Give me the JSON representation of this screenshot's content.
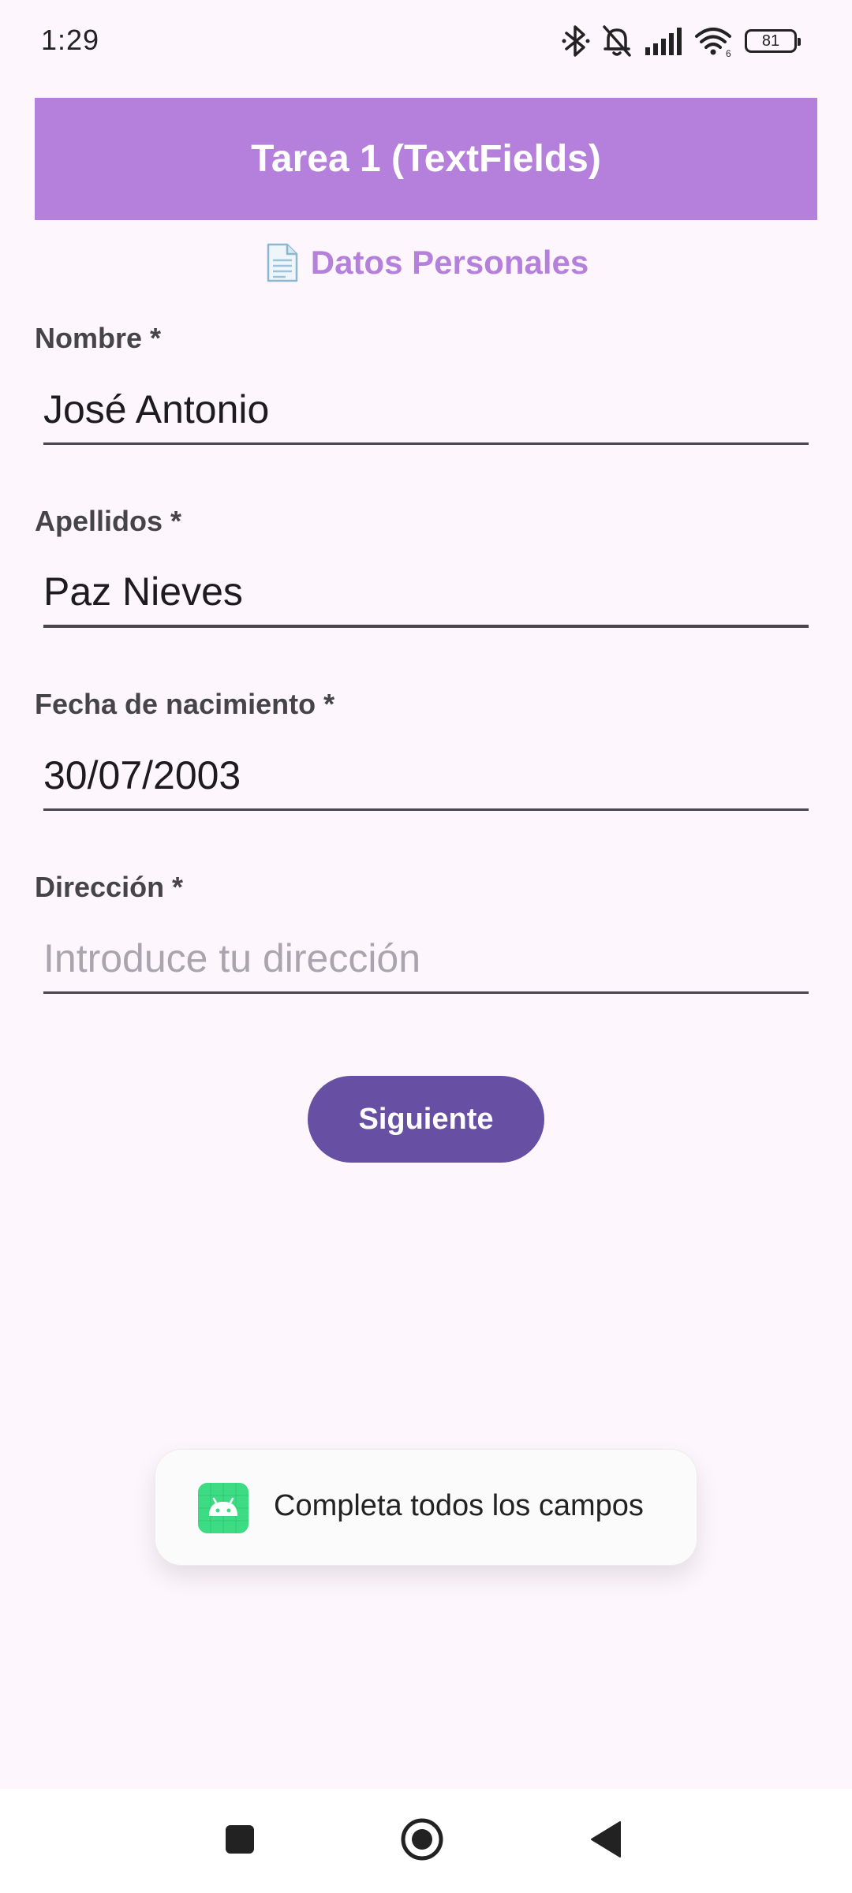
{
  "status_bar": {
    "time": "1:29",
    "battery_level": "81",
    "icons": [
      "bluetooth-icon",
      "bell-off-icon",
      "signal-icon",
      "wifi-icon",
      "battery-icon"
    ]
  },
  "app_bar": {
    "title": "Tarea 1 (TextFields)",
    "background_color": "#b580dc"
  },
  "section": {
    "title": "Datos Personales",
    "icon": "document-icon",
    "color": "#b580dc"
  },
  "form": {
    "fields": [
      {
        "label": "Nombre *",
        "value": "José Antonio",
        "placeholder": ""
      },
      {
        "label": "Apellidos *",
        "value": "Paz Nieves",
        "placeholder": ""
      },
      {
        "label": "Fecha de nacimiento *",
        "value": "30/07/2003",
        "placeholder": ""
      },
      {
        "label": "Dirección *",
        "value": "",
        "placeholder": "Introduce tu dirección"
      }
    ],
    "submit_label": "Siguiente",
    "submit_color": "#6750a4"
  },
  "toast": {
    "message": "Completa todos los campos",
    "icon": "android-app-icon"
  },
  "nav_bar": {
    "buttons": [
      "recents-icon",
      "home-icon",
      "back-icon"
    ]
  }
}
